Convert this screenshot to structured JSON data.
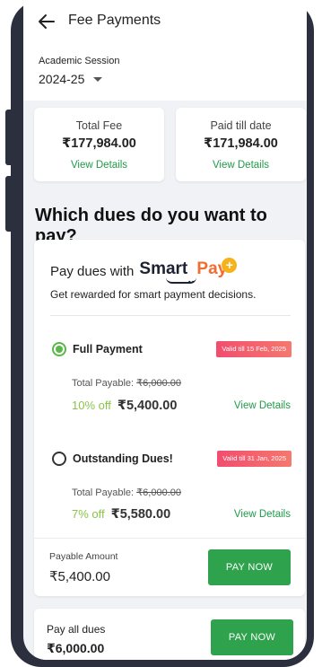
{
  "header": {
    "title": "Fee Payments",
    "back_icon": "arrow-left-icon"
  },
  "session": {
    "label": "Academic Session",
    "value": "2024-25"
  },
  "summary": {
    "total_fee": {
      "label": "Total Fee",
      "amount": "₹177,984.00",
      "link": "View Details"
    },
    "paid": {
      "label": "Paid till date",
      "amount": "₹171,984.00",
      "link": "View Details"
    }
  },
  "question": "Which dues do you want to pay?",
  "smart_pay": {
    "prefix": "Pay dues with",
    "logo_smart": "Smart",
    "logo_dots": "..",
    "logo_pay": "Pay",
    "logo_plus": "+",
    "tagline": "Get rewarded for smart payment decisions."
  },
  "options": [
    {
      "label": "Full Payment",
      "selected": true,
      "badge": "Valid till 15 Feb, 2025",
      "payable_label": "Total Payable:",
      "payable_original": "₹6,000.00",
      "discount": "10% off",
      "price": "₹5,400.00",
      "link": "View Details"
    },
    {
      "label": "Outstanding Dues!",
      "selected": false,
      "badge": "Valid till 31 Jan, 2025",
      "payable_label": "Total Payable:",
      "payable_original": "₹6,000.00",
      "discount": "7% off",
      "price": "₹5,580.00",
      "link": "View Details"
    }
  ],
  "payable": {
    "label": "Payable Amount",
    "amount": "₹5,400.00",
    "button": "PAY NOW"
  },
  "pay_all": {
    "label": "Pay all dues",
    "amount": "₹6,000.00",
    "button": "PAY NOW"
  },
  "colors": {
    "accent_green": "#2ea24c",
    "link_green": "#1f9b48",
    "discount_green": "#8bc34a",
    "badge_pink": "#f24d6e",
    "smart_orange": "#f46b2f"
  }
}
